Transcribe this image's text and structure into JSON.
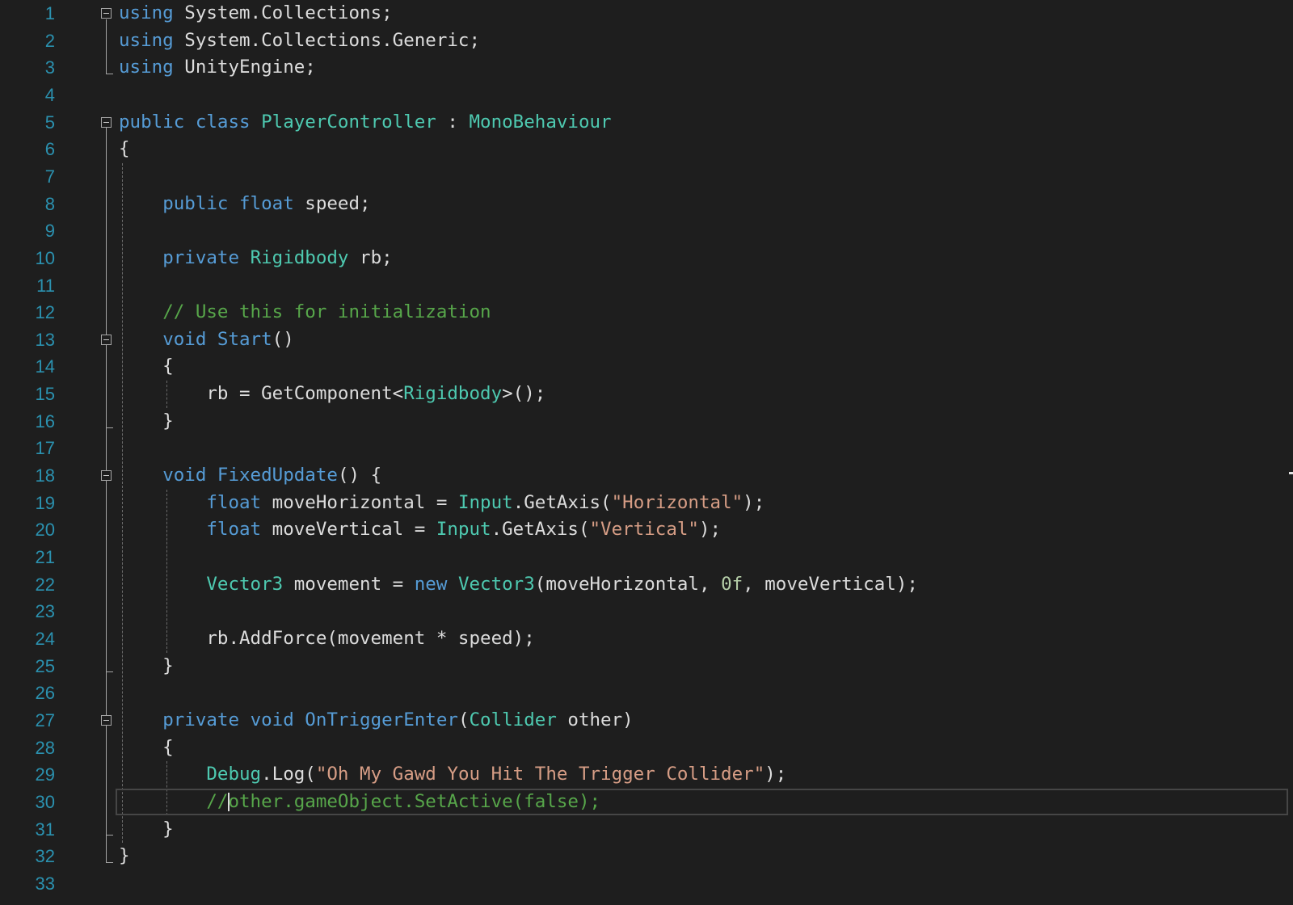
{
  "editor": {
    "language": "C#",
    "current_line": 30,
    "caret": {
      "line": 30,
      "column": 3
    },
    "colors": {
      "background": "#1e1e1e",
      "line_number": "#2b91af",
      "keyword": "#569cd6",
      "type": "#4ec9b0",
      "string": "#d69d85",
      "comment": "#57a64a",
      "number": "#b5cea8",
      "text": "#dcdcdc",
      "current_line_border": "#464646"
    },
    "fold_icons": "fold-collapse-icon",
    "lines": [
      {
        "n": "1",
        "fold": true,
        "tokens": [
          [
            "kw",
            "using"
          ],
          [
            "txt",
            " System.Collections;"
          ]
        ]
      },
      {
        "n": "2",
        "tokens": [
          [
            "kw",
            "using"
          ],
          [
            "txt",
            " System.Collections.Generic;"
          ]
        ]
      },
      {
        "n": "3",
        "tokens": [
          [
            "kw",
            "using"
          ],
          [
            "txt",
            " UnityEngine;"
          ]
        ]
      },
      {
        "n": "4",
        "tokens": []
      },
      {
        "n": "5",
        "fold": true,
        "tokens": [
          [
            "kw",
            "public"
          ],
          [
            "txt",
            " "
          ],
          [
            "kw",
            "class"
          ],
          [
            "txt",
            " "
          ],
          [
            "type",
            "PlayerController"
          ],
          [
            "txt",
            " : "
          ],
          [
            "type",
            "MonoBehaviour"
          ]
        ]
      },
      {
        "n": "6",
        "tokens": [
          [
            "txt",
            "{"
          ]
        ]
      },
      {
        "n": "7",
        "tokens": []
      },
      {
        "n": "8",
        "tokens": [
          [
            "txt",
            "    "
          ],
          [
            "kw",
            "public"
          ],
          [
            "txt",
            " "
          ],
          [
            "kw",
            "float"
          ],
          [
            "txt",
            " speed;"
          ]
        ]
      },
      {
        "n": "9",
        "tokens": []
      },
      {
        "n": "10",
        "tokens": [
          [
            "txt",
            "    "
          ],
          [
            "kw",
            "private"
          ],
          [
            "txt",
            " "
          ],
          [
            "type",
            "Rigidbody"
          ],
          [
            "txt",
            " rb;"
          ]
        ]
      },
      {
        "n": "11",
        "tokens": []
      },
      {
        "n": "12",
        "tokens": [
          [
            "txt",
            "    "
          ],
          [
            "com",
            "// Use this for initialization"
          ]
        ]
      },
      {
        "n": "13",
        "fold": true,
        "tokens": [
          [
            "txt",
            "    "
          ],
          [
            "kw",
            "void"
          ],
          [
            "txt",
            " "
          ],
          [
            "kw",
            "Start"
          ],
          [
            "txt",
            "()"
          ]
        ]
      },
      {
        "n": "14",
        "tokens": [
          [
            "txt",
            "    {"
          ]
        ]
      },
      {
        "n": "15",
        "tokens": [
          [
            "txt",
            "        rb = GetComponent<"
          ],
          [
            "type",
            "Rigidbody"
          ],
          [
            "txt",
            ">();"
          ]
        ]
      },
      {
        "n": "16",
        "tokens": [
          [
            "txt",
            "    }"
          ]
        ]
      },
      {
        "n": "17",
        "tokens": []
      },
      {
        "n": "18",
        "fold": true,
        "tokens": [
          [
            "txt",
            "    "
          ],
          [
            "kw",
            "void"
          ],
          [
            "txt",
            " "
          ],
          [
            "kw",
            "FixedUpdate"
          ],
          [
            "txt",
            "() {"
          ]
        ]
      },
      {
        "n": "19",
        "tokens": [
          [
            "txt",
            "        "
          ],
          [
            "kw",
            "float"
          ],
          [
            "txt",
            " moveHorizontal = "
          ],
          [
            "type",
            "Input"
          ],
          [
            "txt",
            ".GetAxis("
          ],
          [
            "str",
            "\"Horizontal\""
          ],
          [
            "txt",
            ");"
          ]
        ]
      },
      {
        "n": "20",
        "tokens": [
          [
            "txt",
            "        "
          ],
          [
            "kw",
            "float"
          ],
          [
            "txt",
            " moveVertical = "
          ],
          [
            "type",
            "Input"
          ],
          [
            "txt",
            ".GetAxis("
          ],
          [
            "str",
            "\"Vertical\""
          ],
          [
            "txt",
            ");"
          ]
        ]
      },
      {
        "n": "21",
        "tokens": []
      },
      {
        "n": "22",
        "tokens": [
          [
            "txt",
            "        "
          ],
          [
            "type",
            "Vector3"
          ],
          [
            "txt",
            " movement = "
          ],
          [
            "kw",
            "new"
          ],
          [
            "txt",
            " "
          ],
          [
            "type",
            "Vector3"
          ],
          [
            "txt",
            "(moveHorizontal, "
          ],
          [
            "num",
            "0f"
          ],
          [
            "txt",
            ", moveVertical);"
          ]
        ]
      },
      {
        "n": "23",
        "tokens": []
      },
      {
        "n": "24",
        "tokens": [
          [
            "txt",
            "        rb.AddForce(movement * speed);"
          ]
        ]
      },
      {
        "n": "25",
        "tokens": [
          [
            "txt",
            "    }"
          ]
        ]
      },
      {
        "n": "26",
        "tokens": []
      },
      {
        "n": "27",
        "fold": true,
        "tokens": [
          [
            "txt",
            "    "
          ],
          [
            "kw",
            "private"
          ],
          [
            "txt",
            " "
          ],
          [
            "kw",
            "void"
          ],
          [
            "txt",
            " "
          ],
          [
            "kw",
            "OnTriggerEnter"
          ],
          [
            "txt",
            "("
          ],
          [
            "type",
            "Collider"
          ],
          [
            "txt",
            " other)"
          ]
        ]
      },
      {
        "n": "28",
        "tokens": [
          [
            "txt",
            "    {"
          ]
        ]
      },
      {
        "n": "29",
        "tokens": [
          [
            "txt",
            "        "
          ],
          [
            "type",
            "Debug"
          ],
          [
            "txt",
            ".Log("
          ],
          [
            "str",
            "\"Oh My Gawd You Hit The Trigger Collider\""
          ],
          [
            "txt",
            ");"
          ]
        ]
      },
      {
        "n": "30",
        "tokens": [
          [
            "txt",
            "        "
          ],
          [
            "com",
            "//other.gameObject.SetActive(false);"
          ]
        ]
      },
      {
        "n": "31",
        "tokens": [
          [
            "txt",
            "    }"
          ]
        ]
      },
      {
        "n": "32",
        "tokens": [
          [
            "txt",
            "}"
          ]
        ]
      },
      {
        "n": "33",
        "tokens": []
      }
    ]
  }
}
